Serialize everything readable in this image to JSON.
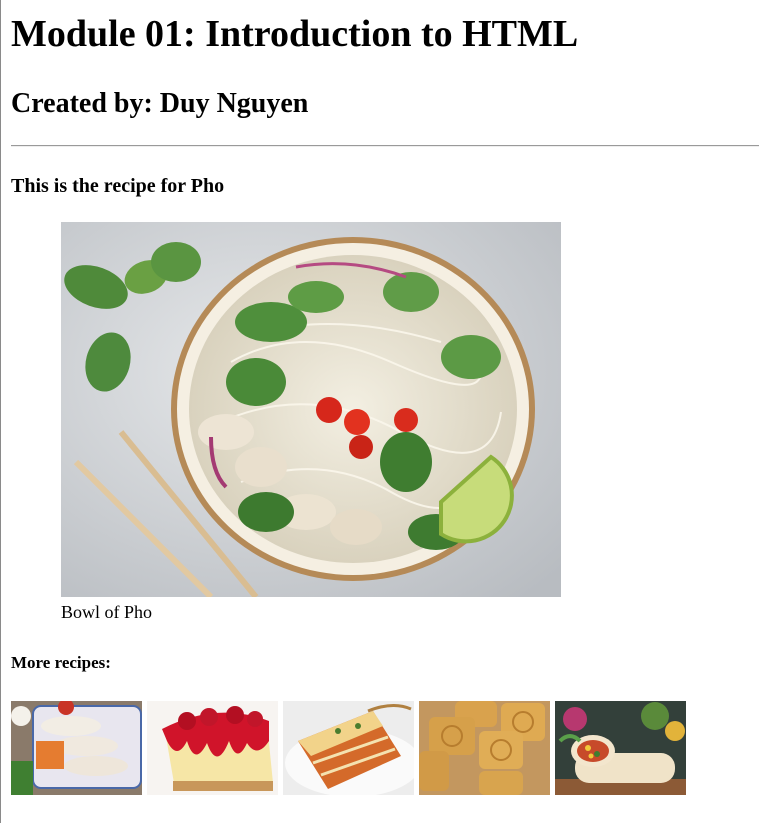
{
  "header": {
    "title": "Module 01: Introduction to HTML",
    "author": "Created by: Duy Nguyen"
  },
  "recipe": {
    "intro": "This is the recipe for Pho",
    "caption": "Bowl of Pho"
  },
  "more": {
    "heading": "More recipes:",
    "thumbnails": [
      {
        "name": "spring-rolls-thumbnail"
      },
      {
        "name": "cheesecake-thumbnail"
      },
      {
        "name": "lasagna-thumbnail"
      },
      {
        "name": "mooncake-thumbnail"
      },
      {
        "name": "burrito-thumbnail"
      }
    ]
  }
}
